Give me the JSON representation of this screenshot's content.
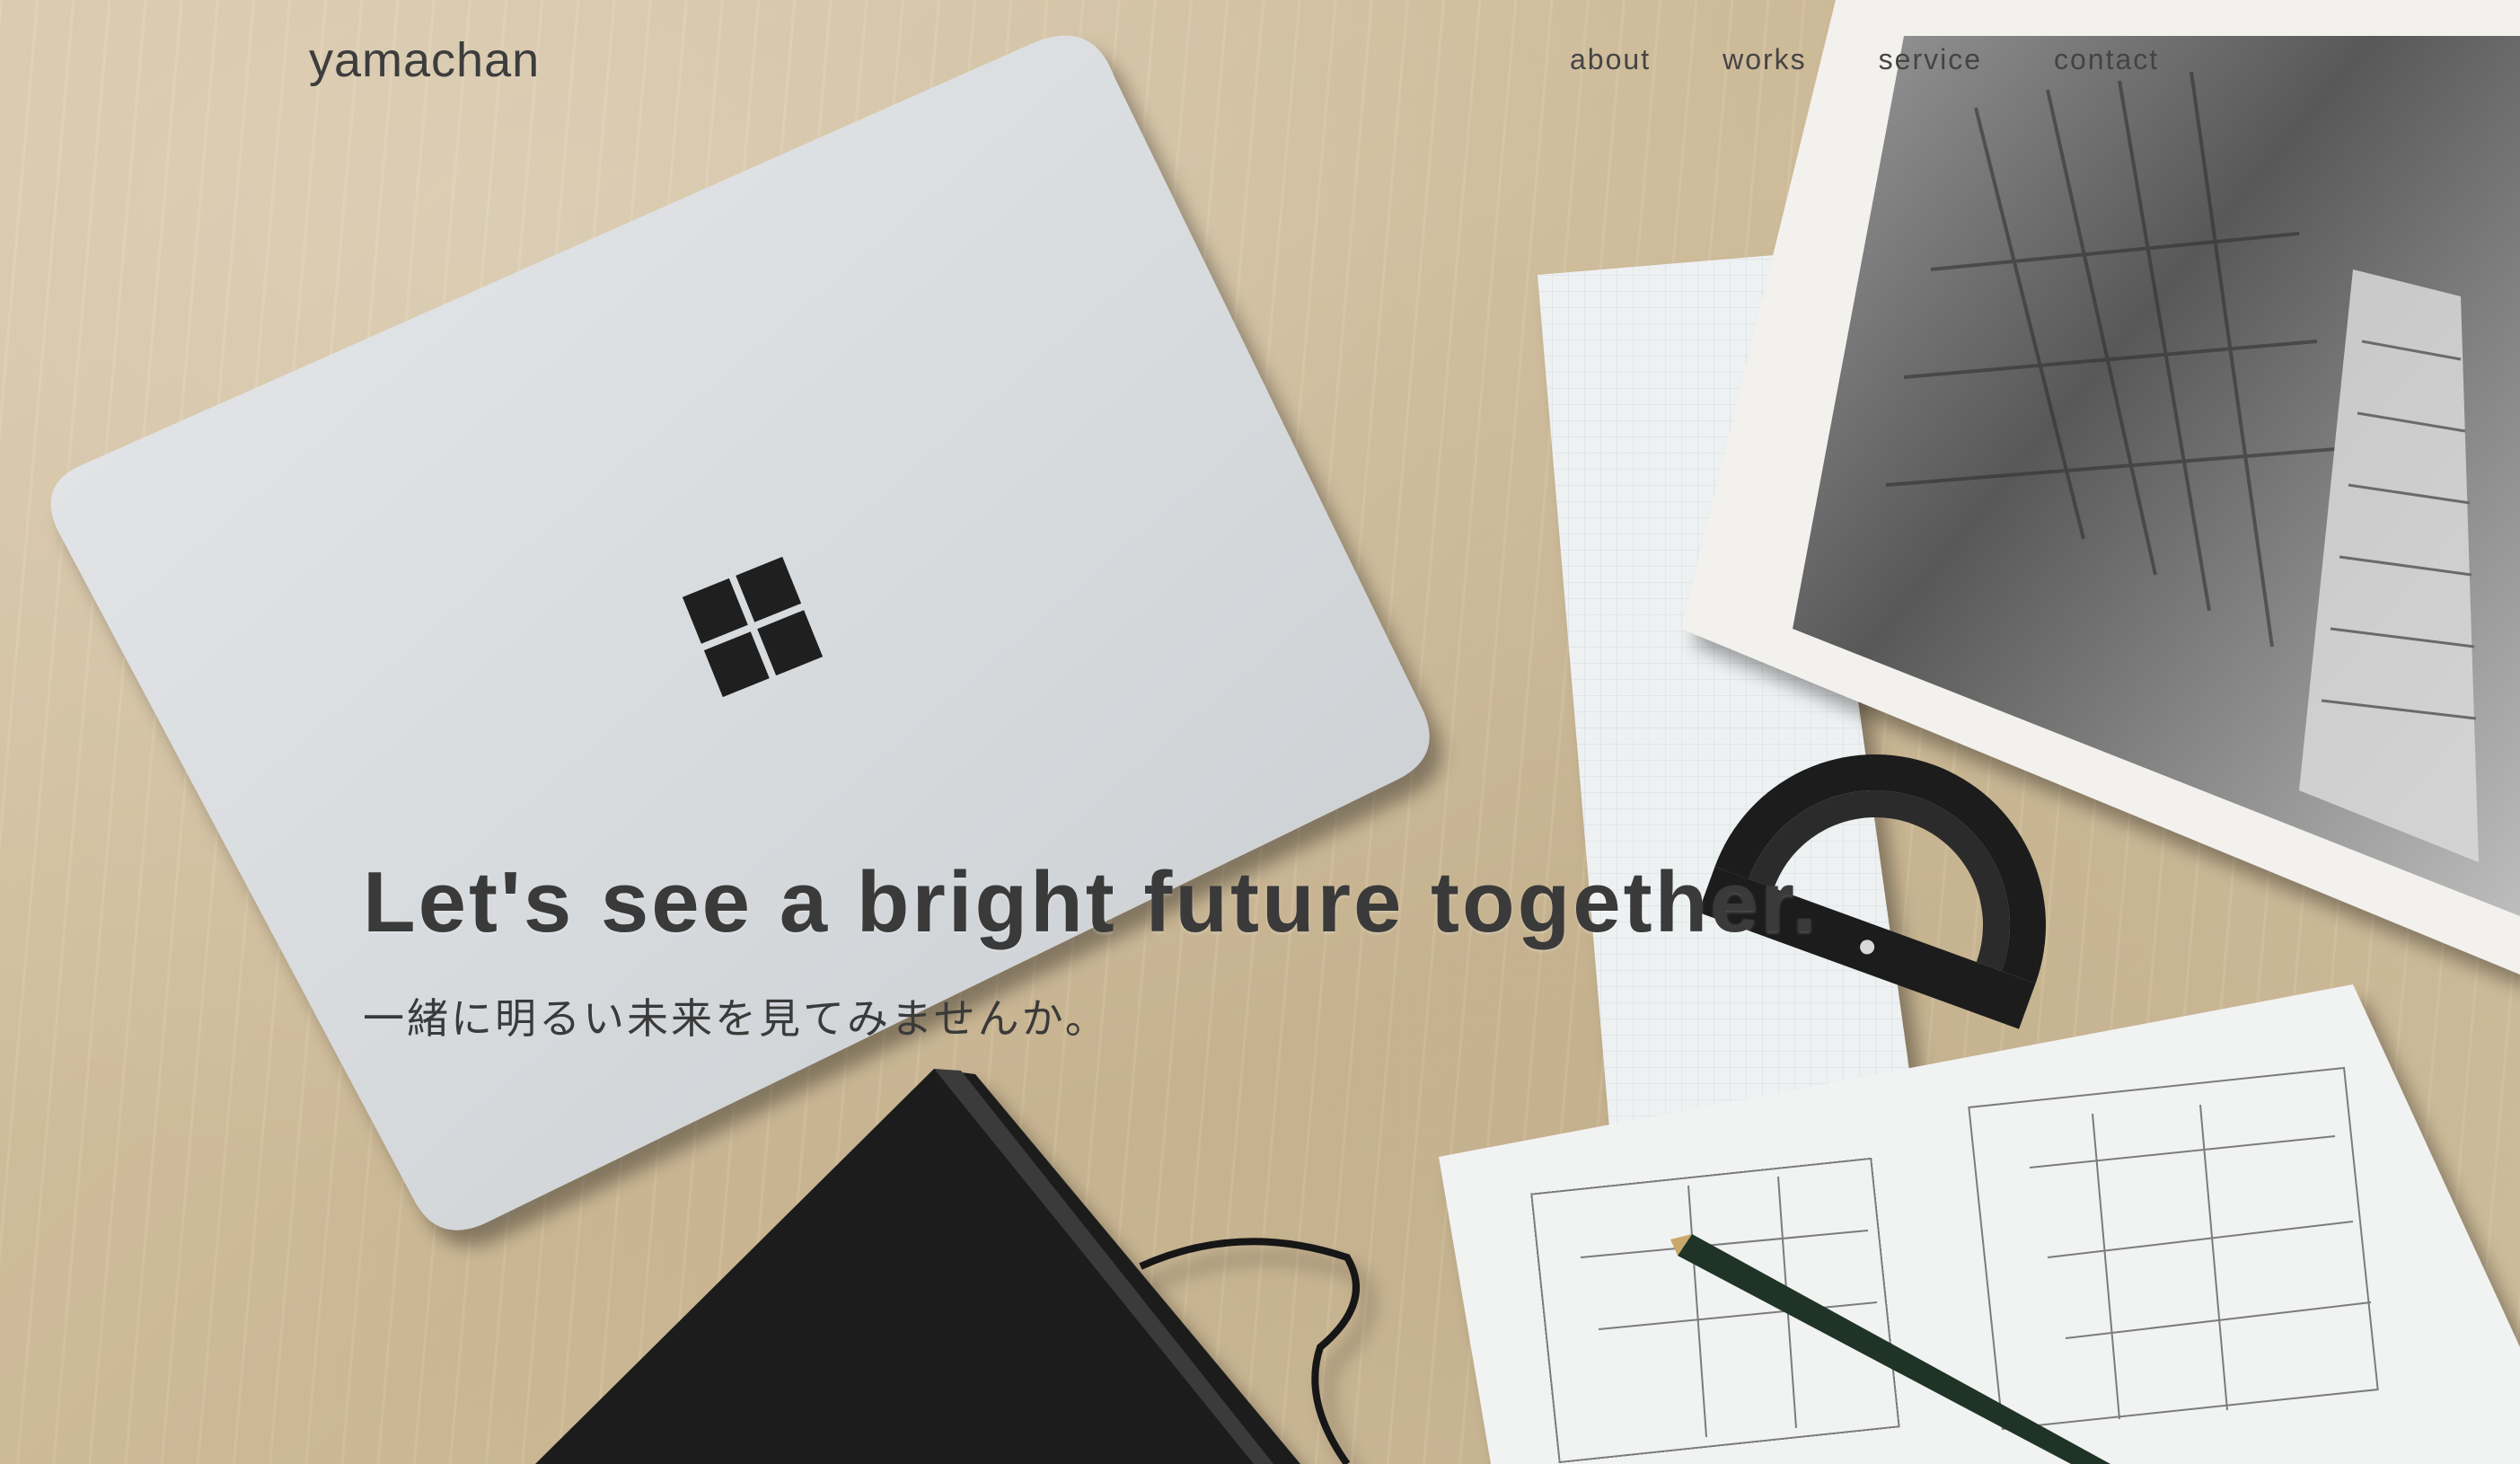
{
  "site": {
    "logo": "yamachan"
  },
  "nav": {
    "items": [
      {
        "label": "about"
      },
      {
        "label": "works"
      },
      {
        "label": "service"
      },
      {
        "label": "contact"
      }
    ]
  },
  "hero": {
    "headline": "Let's see a bright future together.",
    "subheadline": "一緒に明るい未来を見てみませんか。",
    "background_icon": "desk-photo-laptop-notebook-blueprints"
  },
  "colors": {
    "text": "#3a3a3a",
    "background": "#d6c4a2"
  }
}
